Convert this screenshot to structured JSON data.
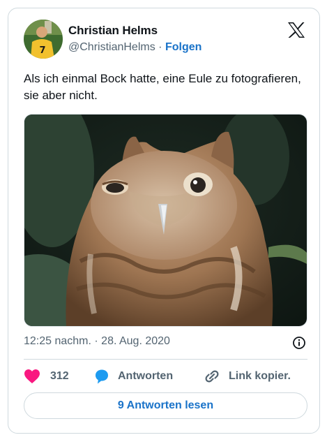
{
  "author": {
    "name": "Christian Helms",
    "handle": "@ChristianHelms",
    "separator": "·",
    "follow_label": "Folgen"
  },
  "tweet": {
    "text": "Als ich einmal Bock hatte, eine Eule zu fotografieren, sie aber nicht.",
    "timestamp": "12:25 nachm. · 28. Aug. 2020"
  },
  "actions": {
    "likes_count": "312",
    "reply_label": "Antworten",
    "copy_link_label": "Link kopier."
  },
  "read_replies_label": "9 Antworten lesen",
  "icons": {
    "platform": "x-logo-icon",
    "info": "info-icon",
    "like": "heart-icon",
    "reply": "speech-bubble-icon",
    "link": "link-icon"
  },
  "colors": {
    "like": "#f91880",
    "reply": "#1d9bf0",
    "link_text": "#1a73c9",
    "muted": "#536471"
  }
}
